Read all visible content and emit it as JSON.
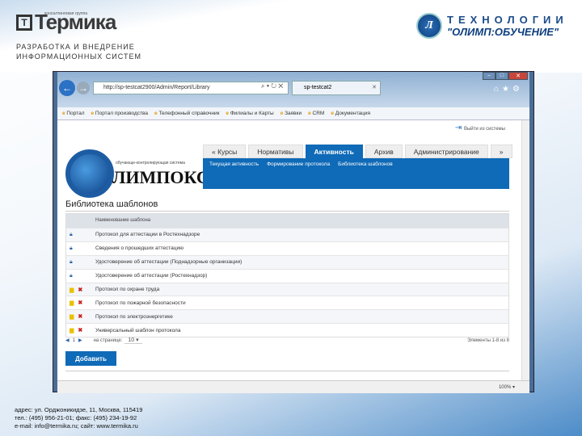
{
  "slide": {
    "company": "Термика",
    "company_sub": "консалтинговая группа",
    "tagline1": "РАЗРАБОТКА И ВНЕДРЕНИЕ",
    "tagline2": "ИНФОРМАЦИОННЫХ СИСТЕМ",
    "partner1": "ТЕХНОЛОГИИ",
    "partner2": "\"ОЛИМП:ОБУЧЕНИЕ\"",
    "address": [
      "адрес: ул. Орджоникидзе, 11, Москва, 115419",
      "тел.: (495) 956-21-01; факс: (495) 234-19-92",
      "e-mail: info@termika.ru; сайт: www.termika.ru"
    ]
  },
  "browser": {
    "url": "http://sp-testcat2900/Admin/Report/Library",
    "tab": "sp-testcat2",
    "favorites": [
      "Портал",
      "Портал производства",
      "Телефонный справочник",
      "Филиалы и Карты",
      "Заявки",
      "CRM",
      "Документация"
    ],
    "zoom": "100%"
  },
  "app": {
    "logout": "Выйти из системы",
    "logo_sub": "обучающе-контролирующая система",
    "logo": "ЛИМПОКС",
    "tabs": [
      {
        "label": "« Курсы"
      },
      {
        "label": "Нормативы"
      },
      {
        "label": "Активность",
        "active": true
      },
      {
        "label": "Архив"
      },
      {
        "label": "Администрирование"
      },
      {
        "label": "»"
      }
    ],
    "subnav": [
      "Текущая активность",
      "Формирование протокола",
      "Библиотека шаблонов"
    ],
    "title": "Библиотека шаблонов",
    "column": "Наименование шаблона",
    "rows": [
      {
        "name": "Протокол для аттестации в Ростехнадзоре",
        "type": "locked"
      },
      {
        "name": "Сведения о прошедших аттестацию",
        "type": "locked"
      },
      {
        "name": "Удостоверение об аттестации (Поднадзорные организации)",
        "type": "locked"
      },
      {
        "name": "Удостоверение об аттестации (Ростехнадзор)",
        "type": "locked"
      },
      {
        "name": "Протокол по охране труда",
        "type": "editable"
      },
      {
        "name": "Протокол по пожарной безопасности",
        "type": "editable"
      },
      {
        "name": "Протокол по электроэнергетике",
        "type": "editable"
      },
      {
        "name": "Универсальный шаблон протокола",
        "type": "editable"
      }
    ],
    "pager": {
      "page": "1",
      "per_page_label": "на странице:",
      "per_page": "10",
      "count": "Элементы 1-8 из 8"
    },
    "add": "Добавить"
  }
}
